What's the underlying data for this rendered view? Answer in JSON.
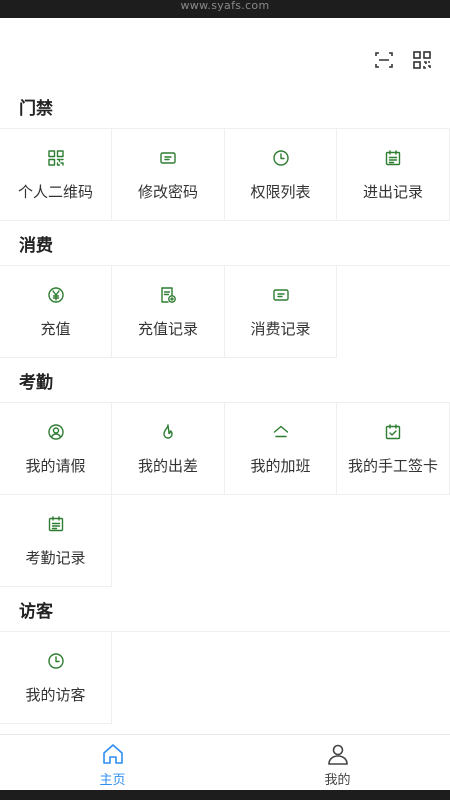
{
  "browser": {
    "watermark_url": "www.syafs.com"
  },
  "header": {
    "icons": [
      "scan-icon",
      "qrcode-icon"
    ]
  },
  "sections": [
    {
      "title": "门禁",
      "items": [
        {
          "label": "个人二维码",
          "icon": "qrcode-icon"
        },
        {
          "label": "修改密码",
          "icon": "ticket-icon"
        },
        {
          "label": "权限列表",
          "icon": "clock-icon"
        },
        {
          "label": "进出记录",
          "icon": "calendar-list-icon"
        }
      ]
    },
    {
      "title": "消费",
      "items": [
        {
          "label": "充值",
          "icon": "yen-icon"
        },
        {
          "label": "充值记录",
          "icon": "receipt-icon"
        },
        {
          "label": "消费记录",
          "icon": "ticket-icon"
        }
      ]
    },
    {
      "title": "考勤",
      "items": [
        {
          "label": "我的请假",
          "icon": "user-circle-icon"
        },
        {
          "label": "我的出差",
          "icon": "flame-icon"
        },
        {
          "label": "我的加班",
          "icon": "home-outline-icon"
        },
        {
          "label": "我的手工签卡",
          "icon": "calendar-check-icon"
        },
        {
          "label": "考勤记录",
          "icon": "calendar-list-icon"
        }
      ]
    },
    {
      "title": "访客",
      "items": [
        {
          "label": "我的访客",
          "icon": "clock-icon"
        }
      ]
    }
  ],
  "tabbar": {
    "tabs": [
      {
        "label": "主页",
        "icon": "home-icon",
        "active": true
      },
      {
        "label": "我的",
        "icon": "user-icon",
        "active": false
      }
    ]
  },
  "colors": {
    "icon_green": "#2e7d32",
    "active_blue": "#2f8ff0",
    "divider": "#efefef"
  }
}
